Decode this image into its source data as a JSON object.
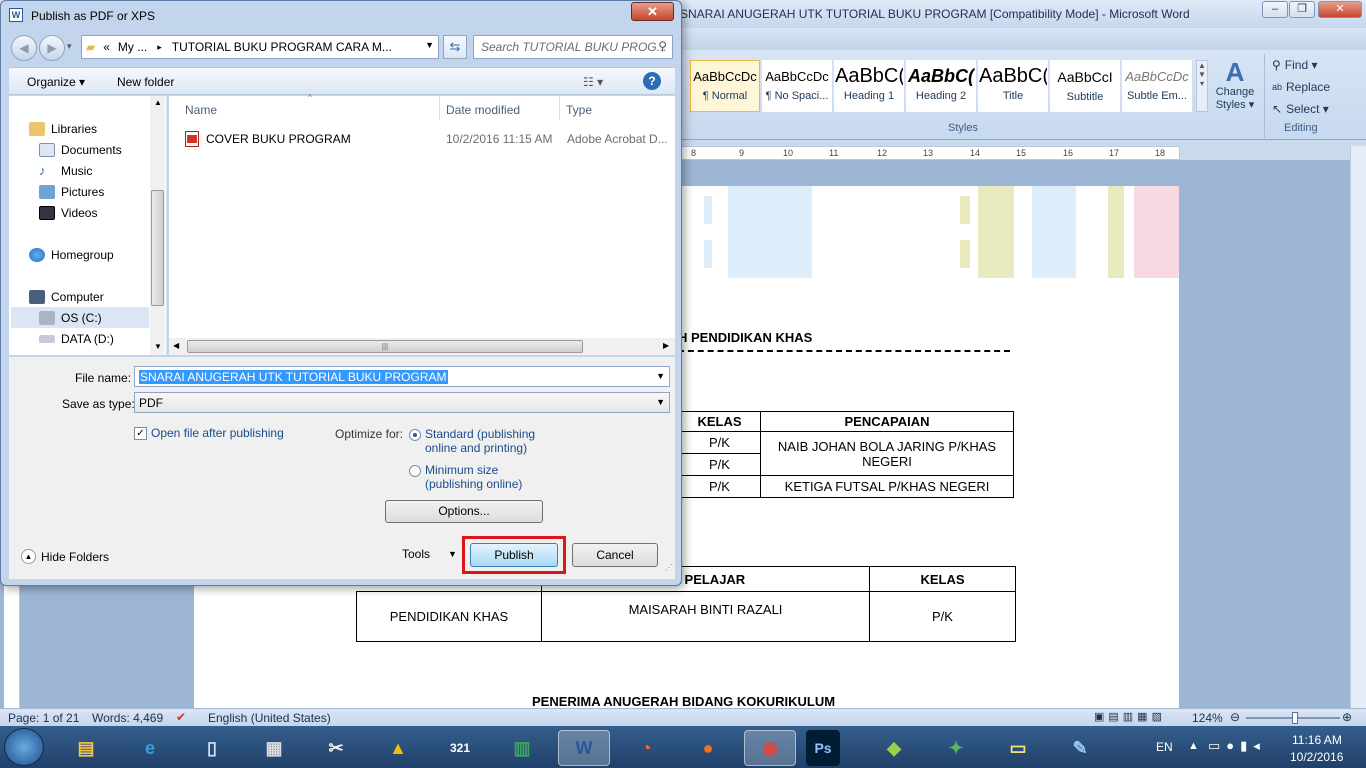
{
  "word": {
    "title": "SNARAI ANUGERAH UTK TUTORIAL BUKU PROGRAM [Compatibility Mode] - Microsoft Word",
    "styles": [
      {
        "sample": "AaBbCcDc",
        "name": "¶ Normal"
      },
      {
        "sample": "AaBbCcDc",
        "name": "¶ No Spaci..."
      },
      {
        "sample": "AaBbC(",
        "name": "Heading 1"
      },
      {
        "sample": "AaBbC(",
        "name": "Heading 2"
      },
      {
        "sample": "AaBbC(",
        "name": "Title"
      },
      {
        "sample": "AaBbCcI",
        "name": "Subtitle"
      },
      {
        "sample": "AaBbCcDc",
        "name": "Subtle Em..."
      }
    ],
    "change_styles_line1": "Change",
    "change_styles_line2": "Styles ▾",
    "styles_group_label": "Styles",
    "editing": {
      "find": "Find ▾",
      "replace": "Replace",
      "select": "Select ▾",
      "label": "Editing"
    },
    "ruler_ticks": [
      "8",
      "9",
      "10",
      "11",
      "12",
      "13",
      "14",
      "15",
      "16",
      "17",
      "18"
    ],
    "doc": {
      "heading1": "H PENDIDIKAN KHAS",
      "table1": {
        "headers": [
          "KELAS",
          "PENCAPAIAN"
        ],
        "rows": [
          [
            "P/K",
            "NAIB JOHAN BOLA JARING P/KHAS NEGERI"
          ],
          [
            "P/K",
            ""
          ],
          [
            "P/K",
            "KETIGA FUTSAL P/KHAS NEGERI"
          ]
        ]
      },
      "table2": {
        "headers": [
          "A PELAJAR",
          "KELAS"
        ],
        "row": [
          "PENDIDIKAN KHAS",
          "MAISARAH BINTI RAZALI",
          "P/K"
        ]
      },
      "heading2": "PENERIMA ANUGERAH BIDANG KOKURIKULUM"
    },
    "status": {
      "page": "Page: 1 of 21",
      "words": "Words: 4,469",
      "language": "English (United States)",
      "zoom": "124%"
    }
  },
  "taskbar": {
    "lang": "EN",
    "time": "11:16 AM",
    "date": "10/2/2016",
    "apps": [
      "start",
      "explorer",
      "ie",
      "recycle",
      "calculator",
      "paint",
      "vlc",
      "321",
      "excel",
      "word",
      "orbit",
      "firefox",
      "chrome",
      "photoshop",
      "bluestacks",
      "reader",
      "notes",
      "palette"
    ]
  },
  "dialog": {
    "title": "Publish as PDF or XPS",
    "close": "✕",
    "address": {
      "prefix": "«",
      "part1": "My ...",
      "sep": "▸",
      "part2": "TUTORIAL BUKU PROGRAM CARA M..."
    },
    "search_placeholder": "Search TUTORIAL BUKU PROG...",
    "toolbar": {
      "organize": "Organize ▾",
      "new_folder": "New folder",
      "view": "☷ ▾",
      "help": "?"
    },
    "nav": [
      {
        "label": "Libraries",
        "icon": "libraries-icon"
      },
      {
        "label": "Documents",
        "icon": "documents-icon"
      },
      {
        "label": "Music",
        "icon": "music-icon"
      },
      {
        "label": "Pictures",
        "icon": "pictures-icon"
      },
      {
        "label": "Videos",
        "icon": "videos-icon"
      },
      {
        "label": "Homegroup",
        "icon": "homegroup-icon"
      },
      {
        "label": "Computer",
        "icon": "computer-icon"
      },
      {
        "label": "OS (C:)",
        "icon": "drive-icon"
      },
      {
        "label": "DATA (D:)",
        "icon": "drive-icon"
      }
    ],
    "columns": [
      "Name",
      "Date modified",
      "Type"
    ],
    "files": [
      {
        "name": "COVER BUKU PROGRAM",
        "date": "10/2/2016 11:15 AM",
        "type": "Adobe Acrobat D..."
      }
    ],
    "file_name_label": "File name:",
    "file_name_value": "SNARAI ANUGERAH UTK TUTORIAL BUKU PROGRAM",
    "save_as_label": "Save as type:",
    "save_as_value": "PDF",
    "open_after_label": "Open file after publishing",
    "optimize_label": "Optimize for:",
    "standard_line1": "Standard (publishing",
    "standard_line2": "online and printing)",
    "minimum_line1": "Minimum size",
    "minimum_line2": "(publishing online)",
    "options_button": "Options...",
    "hide_folders": "Hide Folders",
    "tools": "Tools",
    "publish_button": "Publish",
    "cancel_button": "Cancel"
  }
}
